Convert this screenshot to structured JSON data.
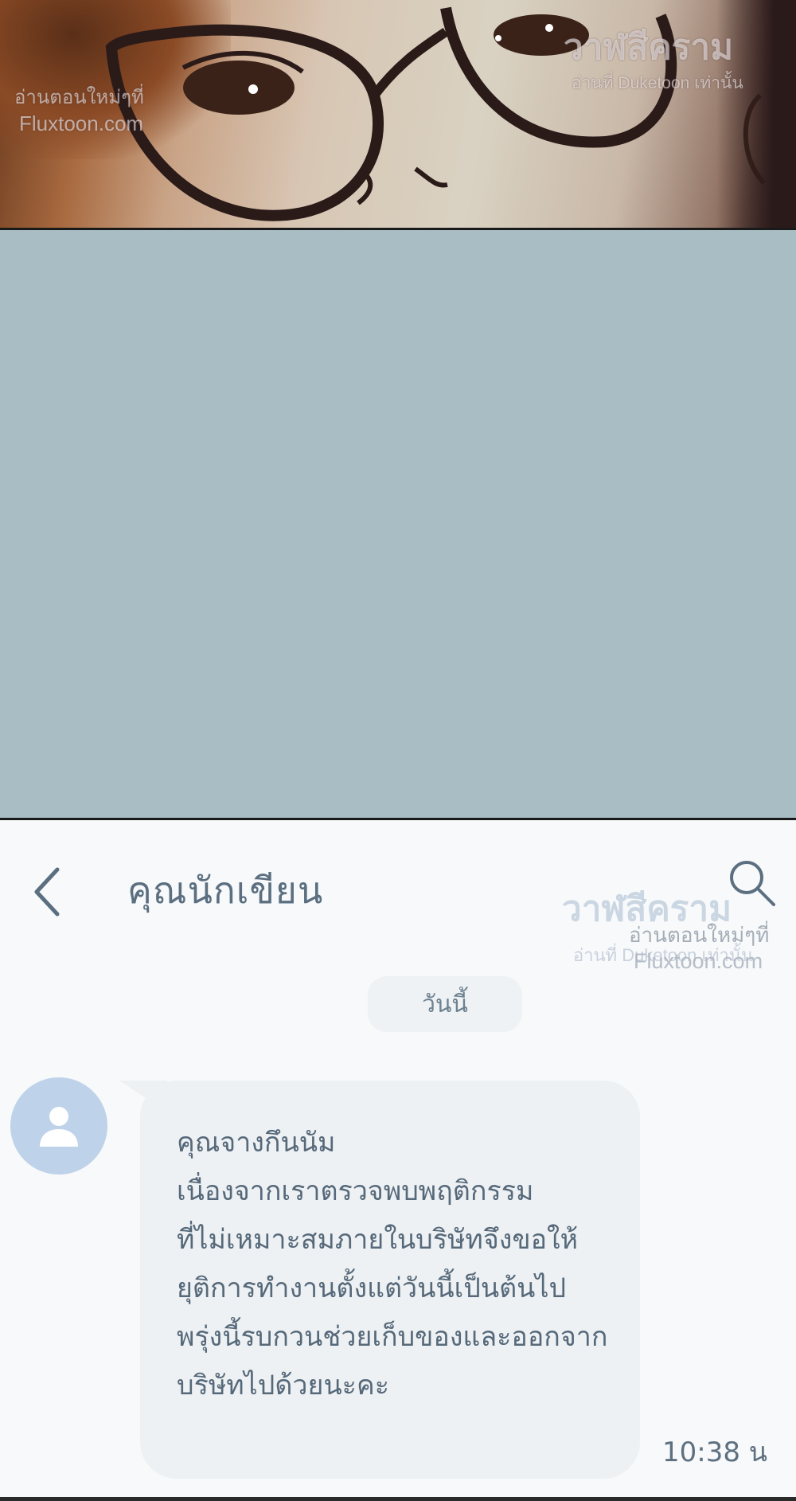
{
  "top_panel": {
    "watermark_left_line1": "อ่านตอนใหม่ๆที่",
    "watermark_left_line2": "Fluxtoon.com",
    "watermark_right_logo": "วาฬสีคราม",
    "watermark_right_line": "อ่านที่ Duketoon เท่านั้น"
  },
  "chat": {
    "title": "คุณนักเขียน",
    "watermark_logo": "วาฬสีคราม",
    "watermark_line1": "อ่านตอนใหม่ๆที่",
    "watermark_line2": "อ่านที่ Duketoon เท่านั้น",
    "watermark_line3": "Fluxtoon.com",
    "date_label": "วันนี้",
    "message_lines": [
      "คุณจางกึนนัม",
      "เนื่องจากเราตรวจพบพฤติกรรม",
      "ที่ไม่เหมาะสมภายในบริษัทจึงขอให้",
      "ยุติการทำงานตั้งแต่วันนี้เป็นต้นไป",
      "พรุ่งนี้รบกวนช่วยเก็บของและออกจาก",
      "บริษัทไปด้วยนะคะ"
    ],
    "timestamp": "10:38 น",
    "icons": {
      "back": "chevron-left-icon",
      "search": "search-icon",
      "avatar": "user-icon"
    }
  }
}
